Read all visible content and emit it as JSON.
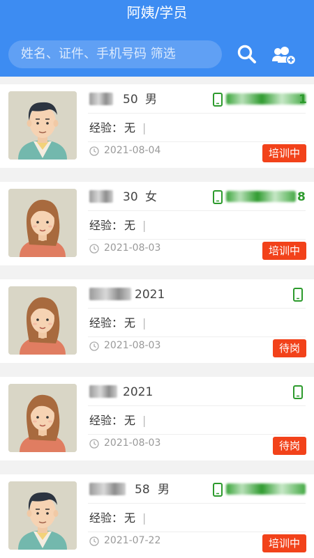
{
  "header": {
    "title": "阿姨/学员",
    "search_placeholder": "姓名、证件、手机号码 筛选",
    "background_color": "#3d8cf2"
  },
  "cards": [
    {
      "name": "",
      "age": "50",
      "gender": "男",
      "phone_tail": "1",
      "exp_label": "经验：",
      "exp_value": "无",
      "date": "2021-08-04",
      "status": "培训中",
      "avatar": "male-avatar",
      "show_phone_number": true
    },
    {
      "name": "",
      "age": "30",
      "gender": "女",
      "phone_tail": "8",
      "exp_label": "经验：",
      "exp_value": "无",
      "date": "2021-08-03",
      "status": "培训中",
      "avatar": "female-avatar",
      "show_phone_number": true
    },
    {
      "name": "",
      "age": "2021",
      "gender": "",
      "phone_tail": "",
      "exp_label": "经验：",
      "exp_value": "无",
      "date": "2021-08-03",
      "status": "待岗",
      "avatar": "female-avatar",
      "show_phone_number": false
    },
    {
      "name": "",
      "age": "2021",
      "gender": "",
      "phone_tail": "",
      "exp_label": "经验：",
      "exp_value": "无",
      "date": "2021-08-03",
      "status": "待岗",
      "avatar": "female-avatar",
      "show_phone_number": false
    },
    {
      "name": "",
      "age": "58",
      "gender": "男",
      "phone_tail": "",
      "exp_label": "经验：",
      "exp_value": "无",
      "date": "2021-07-22",
      "status": "培训中",
      "avatar": "male-avatar",
      "show_phone_number": true
    }
  ],
  "colors": {
    "status_badge": "#f2421a",
    "phone": "#2c9a2c"
  }
}
